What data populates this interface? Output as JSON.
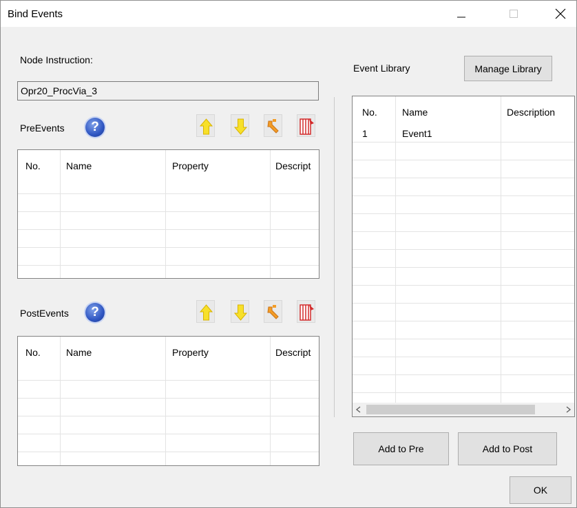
{
  "window": {
    "title": "Bind Events"
  },
  "node_instruction": {
    "label": "Node Instruction:",
    "value": "Opr20_ProcVia_3"
  },
  "pre_events": {
    "label": "PreEvents",
    "columns": [
      "No.",
      "Name",
      "Property",
      "Descript"
    ]
  },
  "post_events": {
    "label": "PostEvents",
    "columns": [
      "No.",
      "Name",
      "Property",
      "Descript"
    ]
  },
  "event_library": {
    "label": "Event Library",
    "manage_button": "Manage Library",
    "columns": [
      "No.",
      "Name",
      "Description"
    ],
    "rows": [
      {
        "no": "1",
        "name": "Event1",
        "description": ""
      }
    ]
  },
  "buttons": {
    "add_to_pre": "Add to Pre",
    "add_to_post": "Add to Post",
    "ok": "OK"
  },
  "icons": {
    "help": "help-icon",
    "move_up": "arrow-up-icon",
    "move_down": "arrow-down-icon",
    "edit": "wrench-icon",
    "delete": "delete-columns-icon",
    "minimize": "minimize-icon",
    "maximize": "maximize-icon",
    "close": "close-icon"
  },
  "colors": {
    "arrow_fill": "#f7e02a",
    "wrench": "#f39c25",
    "delete": "#d32b2b",
    "help": "#2f56c2"
  }
}
